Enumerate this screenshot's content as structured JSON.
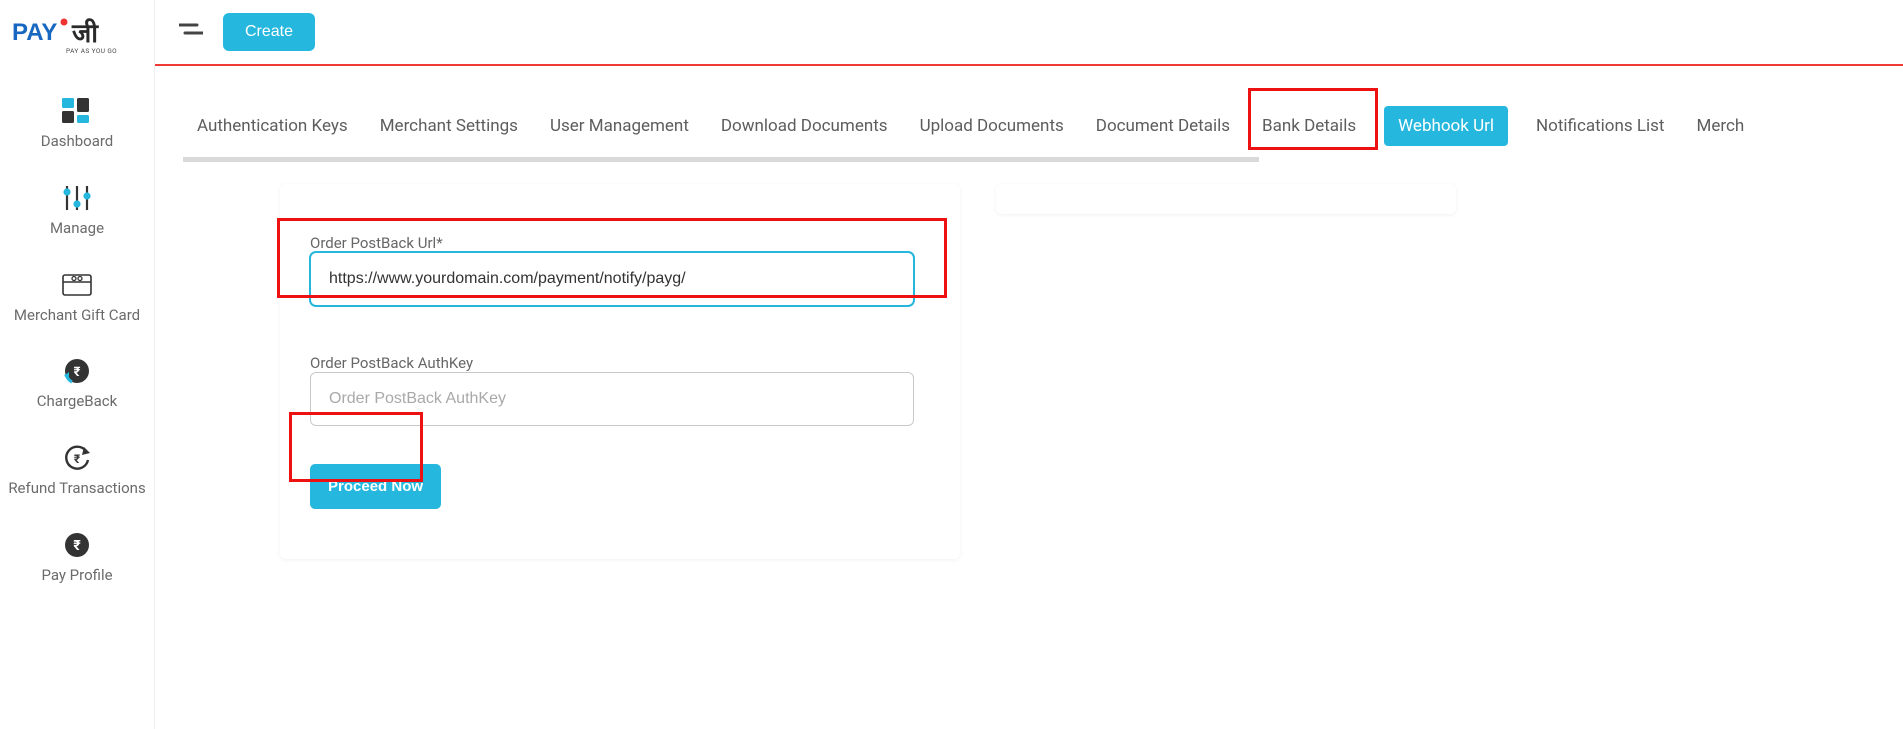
{
  "brand": {
    "name": "PAYG",
    "tagline": "PAY AS YOU GO"
  },
  "topbar": {
    "create_label": "Create"
  },
  "sidebar": {
    "items": [
      {
        "label": "Dashboard",
        "icon": "dashboard-icon"
      },
      {
        "label": "Manage",
        "icon": "sliders-icon"
      },
      {
        "label": "Merchant Gift Card",
        "icon": "giftcard-icon"
      },
      {
        "label": "ChargeBack",
        "icon": "chargeback-icon"
      },
      {
        "label": "Refund Transactions",
        "icon": "refund-icon"
      },
      {
        "label": "Pay Profile",
        "icon": "rupee-icon"
      }
    ]
  },
  "tabs": [
    {
      "label": "Authentication Keys",
      "active": false
    },
    {
      "label": "Merchant Settings",
      "active": false
    },
    {
      "label": "User Management",
      "active": false
    },
    {
      "label": "Download Documents",
      "active": false
    },
    {
      "label": "Upload Documents",
      "active": false
    },
    {
      "label": "Document Details",
      "active": false
    },
    {
      "label": "Bank Details",
      "active": false
    },
    {
      "label": "Webhook Url",
      "active": true
    },
    {
      "label": "Notifications List",
      "active": false
    },
    {
      "label": "Merch",
      "active": false
    }
  ],
  "form": {
    "postback_url": {
      "legend": "Order PostBack Url*",
      "value": "https://www.yourdomain.com/payment/notify/payg/"
    },
    "authkey": {
      "legend": "Order PostBack AuthKey",
      "placeholder": "Order PostBack AuthKey",
      "value": ""
    },
    "submit_label": "Proceed Now"
  },
  "colors": {
    "accent": "#25b7dd",
    "danger_border": "#e11"
  }
}
